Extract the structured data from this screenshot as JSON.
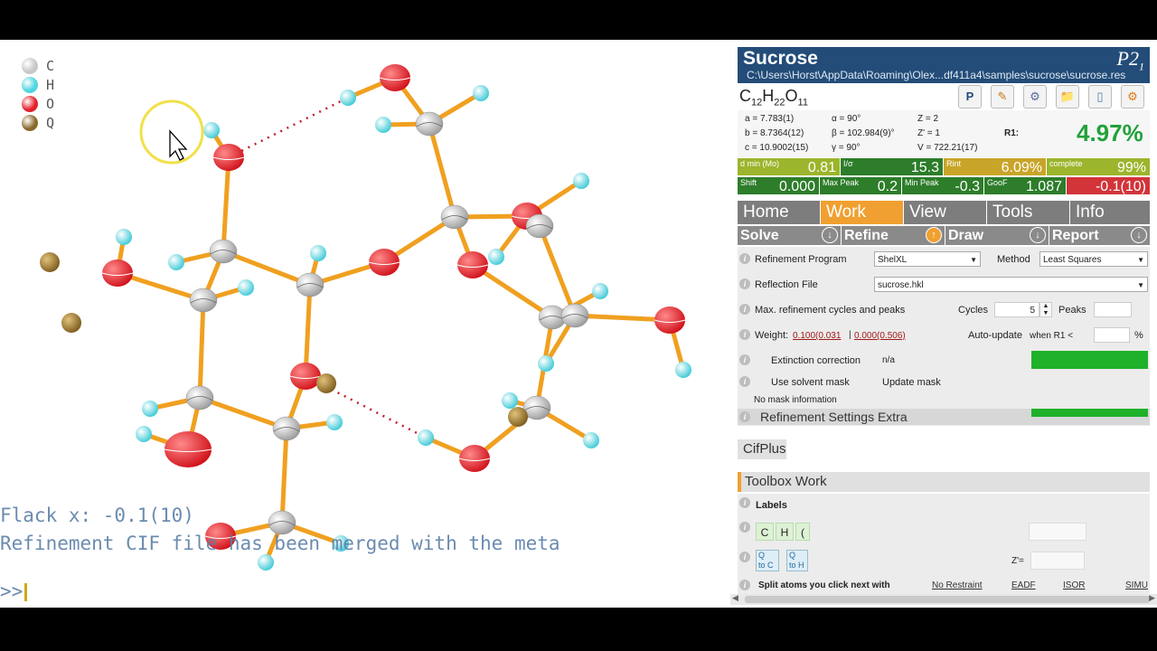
{
  "viewer": {
    "legend": [
      {
        "label": "C",
        "color": "#c8c8c8"
      },
      {
        "label": "H",
        "color": "#4fd6e0"
      },
      {
        "label": "O",
        "color": "#e4202a"
      },
      {
        "label": "Q",
        "color": "#8a6a2a"
      }
    ],
    "console_lines": [
      "Flack x: -0.1(10)",
      "Refinement CIF file has been merged with the meta"
    ],
    "prompt": ">>"
  },
  "header": {
    "title": "Sucrose",
    "path": "C:\\Users\\Horst\\AppData\\Roaming\\Olex...df411a4\\samples\\sucrose\\sucrose.res",
    "space_group_main": "P2",
    "space_group_sub": "1"
  },
  "formula": {
    "c": "C",
    "c_n": "12",
    "h": "H",
    "h_n": "22",
    "o": "O",
    "o_n": "11"
  },
  "toolbar": {
    "icons": [
      {
        "name": "platon-icon",
        "glyph": "P"
      },
      {
        "name": "pencil-icon",
        "glyph": "✎"
      },
      {
        "name": "tools-icon",
        "glyph": "⚙"
      },
      {
        "name": "folder-icon",
        "glyph": "📁"
      },
      {
        "name": "notebook-icon",
        "glyph": "▯"
      },
      {
        "name": "settings-icon",
        "glyph": "⚙"
      }
    ]
  },
  "cell": {
    "a": "a = 7.783(1)",
    "b": "b = 8.7364(12)",
    "c": "c = 10.9002(15)",
    "alpha": "α = 90°",
    "beta": "β = 102.984(9)°",
    "gamma": "γ = 90°",
    "Z": "Z = 2",
    "Zp": "Z' = 1",
    "V": "V = 722.21(17)",
    "r1_label": "R1:",
    "r1_value": "4.97%"
  },
  "stats_row1": [
    {
      "label": "d min (Mo)",
      "value": "0.81",
      "color": "#9bb52c"
    },
    {
      "label": "I/σ",
      "value": "15.3",
      "color": "#2d7d2a"
    },
    {
      "label": "Rint",
      "value": "6.09%",
      "color": "#c8a529"
    },
    {
      "label": "complete",
      "value": "99%",
      "color": "#9bb52c"
    }
  ],
  "stats_row2": [
    {
      "label": "Shift",
      "value": "0.000",
      "color": "#2d7d2a"
    },
    {
      "label": "Max Peak",
      "value": "0.2",
      "color": "#2d7d2a"
    },
    {
      "label": "Min Peak",
      "value": "-0.3",
      "color": "#2d7d2a"
    },
    {
      "label": "GooF",
      "value": "1.087",
      "color": "#2d7d2a"
    },
    {
      "label": "",
      "value": "-0.1(10)",
      "color": "#d2343a"
    }
  ],
  "tabs": [
    {
      "label": "Home",
      "active": false
    },
    {
      "label": "Work",
      "active": true
    },
    {
      "label": "View",
      "active": false
    },
    {
      "label": "Tools",
      "active": false
    },
    {
      "label": "Info",
      "active": false
    }
  ],
  "subtabs": [
    {
      "label": "Solve",
      "arrow": "↓",
      "highlight": false
    },
    {
      "label": "Refine",
      "arrow": "↑",
      "highlight": true
    },
    {
      "label": "Draw",
      "arrow": "↓",
      "highlight": false
    },
    {
      "label": "Report",
      "arrow": "↓",
      "highlight": false
    }
  ],
  "refine": {
    "program_label": "Refinement Program",
    "program_value": "ShelXL",
    "method_label": "Method",
    "method_value": "Least Squares",
    "reflection_label": "Reflection File",
    "reflection_value": "sucrose.hkl",
    "cycles_label": "Max. refinement cycles and peaks",
    "cycles_word": "Cycles",
    "cycles_value": "5",
    "peaks_word": "Peaks",
    "weight_label": "Weight:",
    "weight_1": "0.100(0.031",
    "weight_sep": "|",
    "weight_2": "0.000(0.506)",
    "autoupdate_label": "Auto-update",
    "when_r1": "when R1 <",
    "percent": "%",
    "extinction_label": "Extinction correction",
    "extinction_value": "n/a",
    "solvent_label": "Use solvent mask",
    "update_mask": "Update mask",
    "no_mask": "No mask information",
    "settings_extra": "Refinement Settings Extra"
  },
  "cifplus": "CifPlus",
  "toolbox": {
    "title": "Toolbox Work",
    "labels": "Labels",
    "chips": [
      "C",
      "H",
      "("
    ],
    "zprime": "Z'=",
    "split_label": "Split atoms you click next with",
    "links": [
      "No Restraint",
      "EADF",
      "ISOR",
      "SIMU"
    ]
  }
}
